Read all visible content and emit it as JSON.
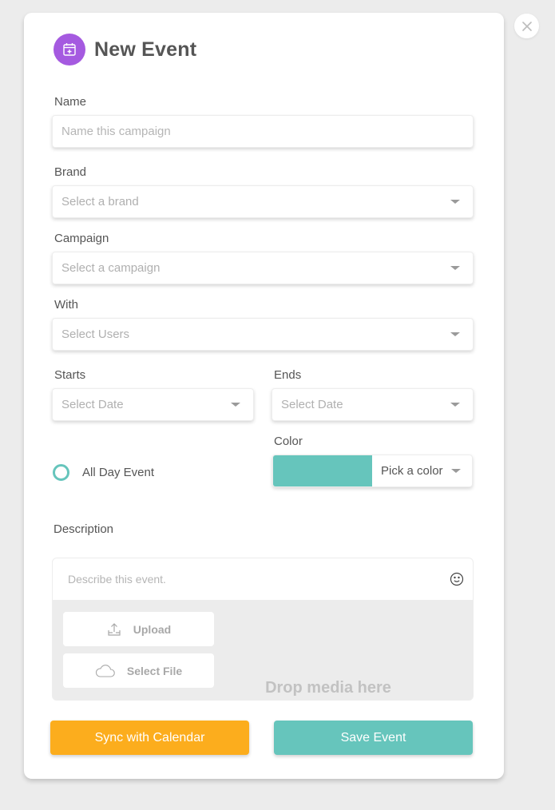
{
  "header": {
    "title": "New Event",
    "icon": "calendar-plus-icon"
  },
  "close": {
    "icon": "close-icon"
  },
  "fields": {
    "name": {
      "label": "Name",
      "placeholder": "Name this campaign",
      "value": ""
    },
    "brand": {
      "label": "Brand",
      "placeholder": "Select a brand"
    },
    "campaign": {
      "label": "Campaign",
      "placeholder": "Select a campaign"
    },
    "with": {
      "label": "With",
      "placeholder": "Select Users"
    },
    "starts": {
      "label": "Starts",
      "placeholder": "Select Date"
    },
    "ends": {
      "label": "Ends",
      "placeholder": "Select Date"
    },
    "color": {
      "label": "Color",
      "select_label": "Pick a color",
      "swatch": "#66c5bc"
    },
    "all_day": {
      "label": "All Day Event",
      "checked": false
    },
    "description": {
      "label": "Description",
      "placeholder": "Describe this event.",
      "emoji_icon": "smiley-icon",
      "upload_label": "Upload",
      "select_file_label": "Select File",
      "drop_text": "Drop media here"
    }
  },
  "actions": {
    "sync_label": "Sync with Calendar",
    "save_label": "Save Event"
  },
  "colors": {
    "accent_purple": "#a55ae0",
    "teal": "#66c5bc",
    "orange": "#fcad1d"
  }
}
